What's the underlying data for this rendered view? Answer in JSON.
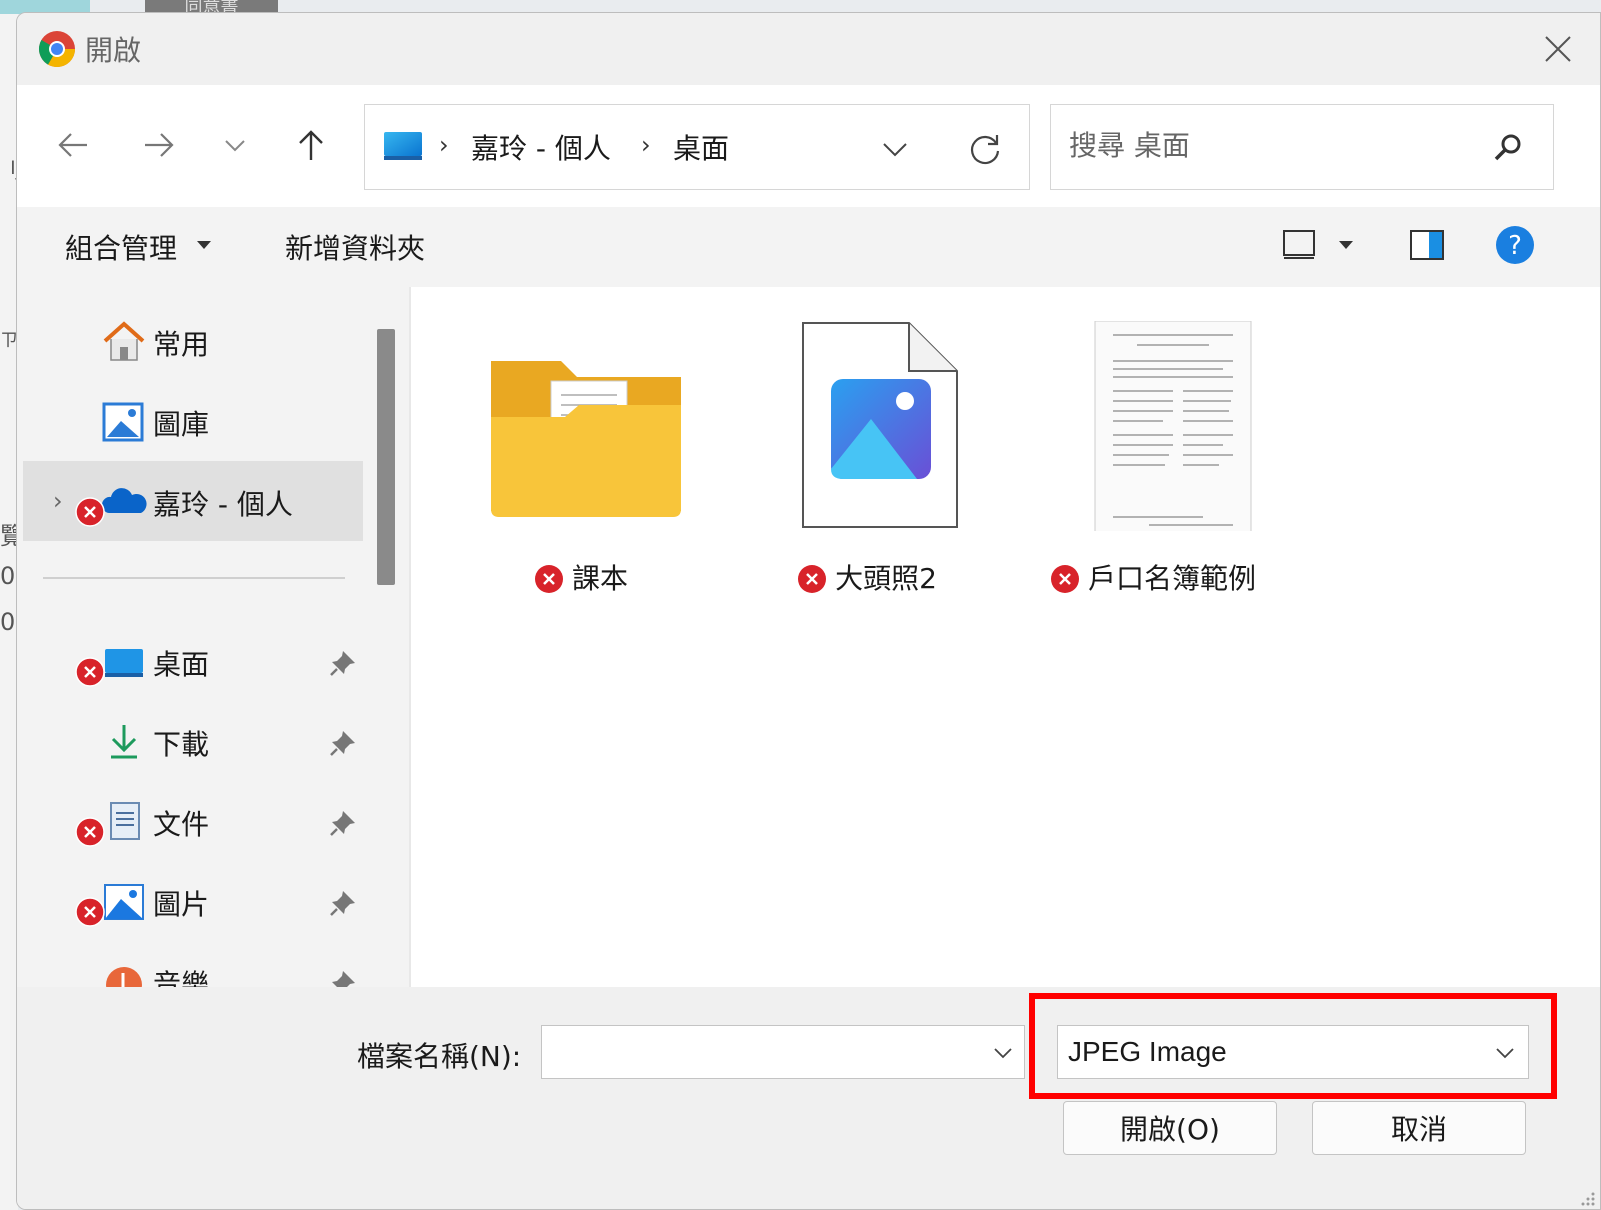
{
  "background": {
    "tab_text": "同意書",
    "side_chars": [
      "刂",
      "ㄗㄩ",
      "覽",
      "0",
      "0"
    ]
  },
  "dialog": {
    "title": "開啟",
    "close_label": "×"
  },
  "navigation": {
    "breadcrumbs": [
      "嘉玲 - 個人",
      "桌面"
    ],
    "search_placeholder": "搜尋 桌面"
  },
  "commandbar": {
    "organize_label": "組合管理",
    "new_folder_label": "新增資料夾"
  },
  "sidebar": {
    "items": [
      {
        "label": "常用",
        "icon": "home-icon",
        "error": false,
        "pinned": false
      },
      {
        "label": "圖庫",
        "icon": "gallery-icon",
        "error": false,
        "pinned": false
      },
      {
        "label": "嘉玲 - 個人",
        "icon": "onedrive-cloud-icon",
        "error": true,
        "pinned": false,
        "selected": true
      },
      {
        "label": "桌面",
        "icon": "desktop-icon",
        "error": true,
        "pinned": true
      },
      {
        "label": "下載",
        "icon": "download-icon",
        "error": false,
        "pinned": true
      },
      {
        "label": "文件",
        "icon": "document-icon",
        "error": true,
        "pinned": true
      },
      {
        "label": "圖片",
        "icon": "pictures-icon",
        "error": true,
        "pinned": true
      },
      {
        "label": "音樂",
        "icon": "music-icon",
        "error": false,
        "pinned": true
      }
    ]
  },
  "files": [
    {
      "name": "課本",
      "icon": "folder-icon",
      "error": true
    },
    {
      "name": "大頭照2",
      "icon": "image-file-icon",
      "error": true
    },
    {
      "name": "戶口名簿範例",
      "icon": "document-thumbnail-icon",
      "error": true
    }
  ],
  "footer": {
    "filename_label": "檔案名稱(N):",
    "filename_value": "",
    "filetype_value": "JPEG Image",
    "open_label": "開啟(O)",
    "cancel_label": "取消"
  },
  "colors": {
    "accent_blue": "#0078d4",
    "error_red": "#d8232a",
    "highlight_red": "#ff0000",
    "folder_yellow": "#f8c53a"
  }
}
